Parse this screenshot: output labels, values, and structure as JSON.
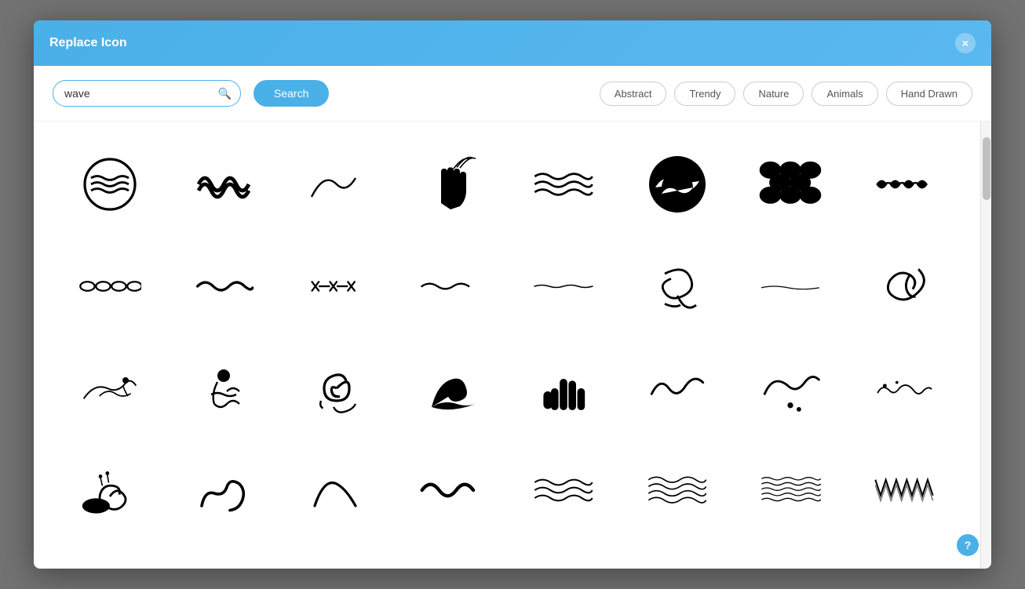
{
  "modal": {
    "title": "Replace Icon",
    "close_label": "×"
  },
  "search": {
    "value": "wave",
    "placeholder": "wave",
    "button_label": "Search"
  },
  "filters": [
    {
      "label": "Abstract",
      "id": "abstract"
    },
    {
      "label": "Trendy",
      "id": "trendy"
    },
    {
      "label": "Nature",
      "id": "nature"
    },
    {
      "label": "Animals",
      "id": "animals"
    },
    {
      "label": "Hand Drawn",
      "id": "hand-drawn"
    }
  ],
  "help_label": "?"
}
